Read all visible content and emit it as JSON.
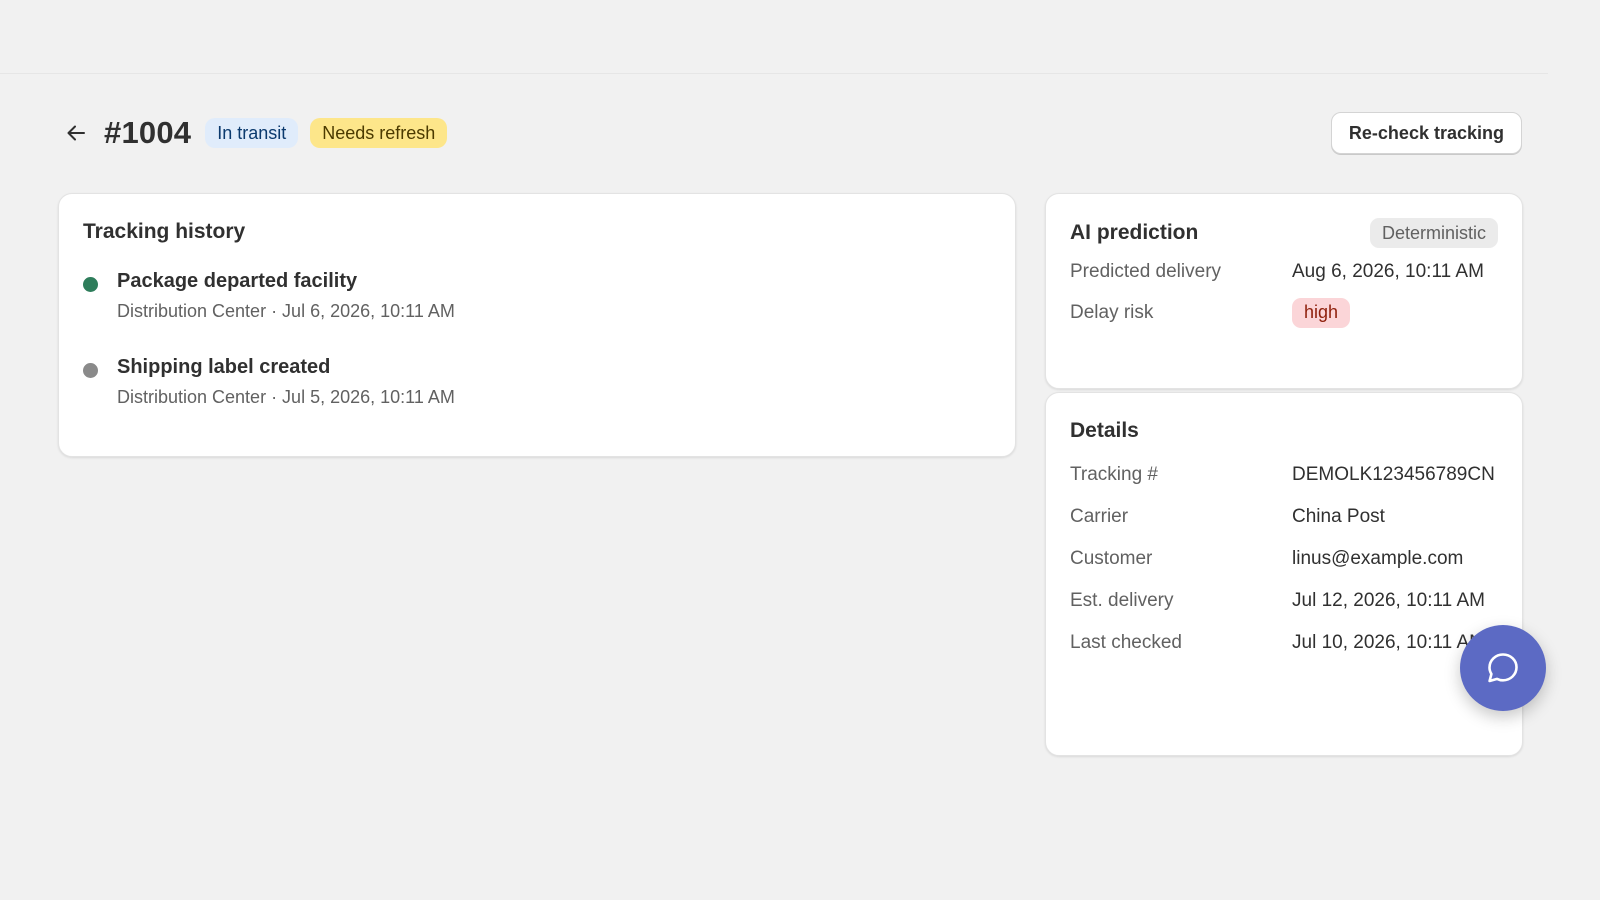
{
  "header": {
    "order_number": "#1004",
    "status_badge": "In transit",
    "refresh_badge": "Needs refresh",
    "recheck_label": "Re-check tracking"
  },
  "tracking": {
    "title": "Tracking history",
    "events": [
      {
        "title": "Package departed facility",
        "subtitle": "Distribution Center · Jul 6, 2026, 10:11 AM",
        "status_color": "#2e7d5b"
      },
      {
        "title": "Shipping label created",
        "subtitle": "Distribution Center · Jul 5, 2026, 10:11 AM",
        "status_color": "#8a8a8a"
      }
    ]
  },
  "ai_prediction": {
    "title": "AI prediction",
    "mode_badge": "Deterministic",
    "predicted_delivery_label": "Predicted delivery",
    "predicted_delivery_value": "Aug 6, 2026, 10:11 AM",
    "delay_risk_label": "Delay risk",
    "delay_risk_value": "high"
  },
  "details": {
    "title": "Details",
    "rows": [
      {
        "label": "Tracking #",
        "value": "DEMOLK123456789CN"
      },
      {
        "label": "Carrier",
        "value": "China Post"
      },
      {
        "label": "Customer",
        "value": "linus@example.com"
      },
      {
        "label": "Est. delivery",
        "value": "Jul 12, 2026, 10:11 AM"
      },
      {
        "label": "Last checked",
        "value": "Jul 10, 2026, 10:11 AM"
      }
    ]
  },
  "icons": {
    "back": "arrow-left-icon",
    "chat": "chat-bubble-icon"
  },
  "colors": {
    "chat_fab": "#5c6ac4",
    "info_badge": "#e0ecfb",
    "warning_badge": "#fde68a",
    "critical_badge": "#fbd5d8"
  }
}
